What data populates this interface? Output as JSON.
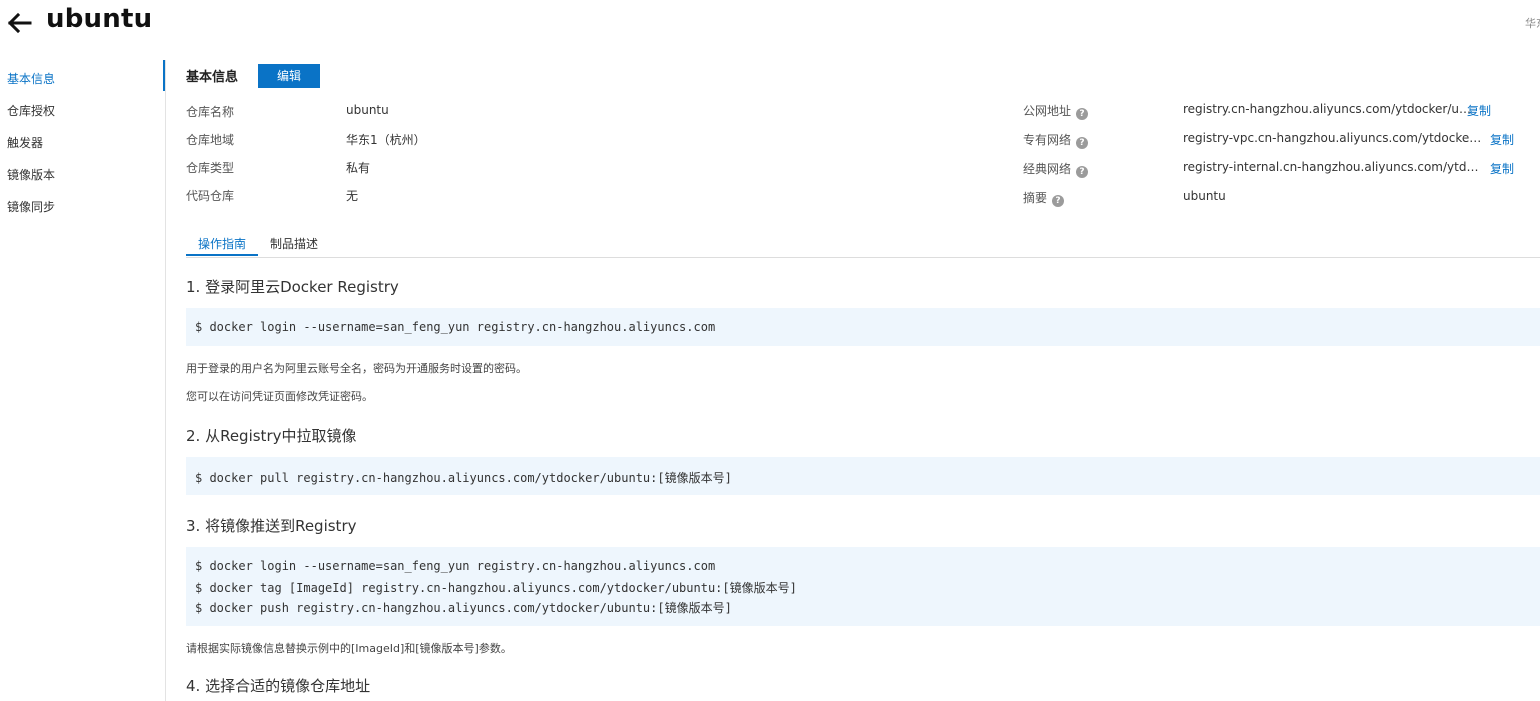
{
  "header": {
    "title": "ubuntu",
    "region": "华东"
  },
  "sidebar": {
    "items": [
      {
        "label": "基本信息"
      },
      {
        "label": "仓库授权"
      },
      {
        "label": "触发器"
      },
      {
        "label": "镜像版本"
      },
      {
        "label": "镜像同步"
      }
    ]
  },
  "basic_info": {
    "section_title": "基本信息",
    "edit_label": "编辑",
    "fields": [
      {
        "label": "仓库名称",
        "value": "ubuntu"
      },
      {
        "label": "仓库地域",
        "value": "华东1（杭州）"
      },
      {
        "label": "仓库类型",
        "value": "私有"
      },
      {
        "label": "代码仓库",
        "value": "无"
      }
    ],
    "addresses": [
      {
        "label": "公网地址",
        "value": "registry.cn-hangzhou.aliyuncs.com/ytdocker/ubuntu",
        "copy": "复制"
      },
      {
        "label": "专有网络",
        "value": "registry-vpc.cn-hangzhou.aliyuncs.com/ytdocker/ubuntu",
        "copy": "复制"
      },
      {
        "label": "经典网络",
        "value": "registry-internal.cn-hangzhou.aliyuncs.com/ytdocker/ubuntu",
        "copy": "复制"
      },
      {
        "label": "摘要",
        "value": "ubuntu"
      }
    ],
    "help_icon": "question-circle-icon"
  },
  "tabs": [
    {
      "label": "操作指南"
    },
    {
      "label": "制品描述"
    }
  ],
  "guide": {
    "step1": {
      "title": "1. 登录阿里云Docker Registry",
      "code": [
        "$ docker login --username=san_feng_yun registry.cn-hangzhou.aliyuncs.com"
      ],
      "notes": [
        "用于登录的用户名为阿里云账号全名，密码为开通服务时设置的密码。",
        "您可以在访问凭证页面修改凭证密码。"
      ]
    },
    "step2": {
      "title": "2. 从Registry中拉取镜像",
      "code": [
        "$ docker pull registry.cn-hangzhou.aliyuncs.com/ytdocker/ubuntu:[镜像版本号]"
      ]
    },
    "step3": {
      "title": "3. 将镜像推送到Registry",
      "code": [
        "$ docker login --username=san_feng_yun registry.cn-hangzhou.aliyuncs.com",
        "$ docker tag [ImageId] registry.cn-hangzhou.aliyuncs.com/ytdocker/ubuntu:[镜像版本号]",
        "$ docker push registry.cn-hangzhou.aliyuncs.com/ytdocker/ubuntu:[镜像版本号]"
      ],
      "note": "请根据实际镜像信息替换示例中的[ImageId]和[镜像版本号]参数。"
    },
    "step4": {
      "title": "4. 选择合适的镜像仓库地址"
    }
  },
  "colors": {
    "accent": "#0a73c6",
    "code_bg": "#eef6fd",
    "help_icon": "#9b9b9b"
  }
}
